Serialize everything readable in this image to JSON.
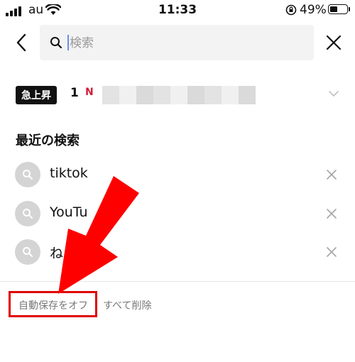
{
  "status_bar": {
    "carrier": "au",
    "time": "11:33",
    "battery_percent": "49%",
    "battery_level": 0.49
  },
  "search": {
    "placeholder": "検索",
    "value": ""
  },
  "trending": {
    "badge": "急上昇",
    "rank": "1",
    "new_mark": "N"
  },
  "recent": {
    "title": "最近の検索",
    "items": [
      {
        "label": "tiktok"
      },
      {
        "label": "YouTu"
      },
      {
        "label": "ね"
      }
    ]
  },
  "footer": {
    "auto_save_off": "自動保存をオフ",
    "delete_all": "すべて削除"
  },
  "annotation": {
    "highlight_color": "#e00000",
    "arrow_color": "#ff0000"
  }
}
